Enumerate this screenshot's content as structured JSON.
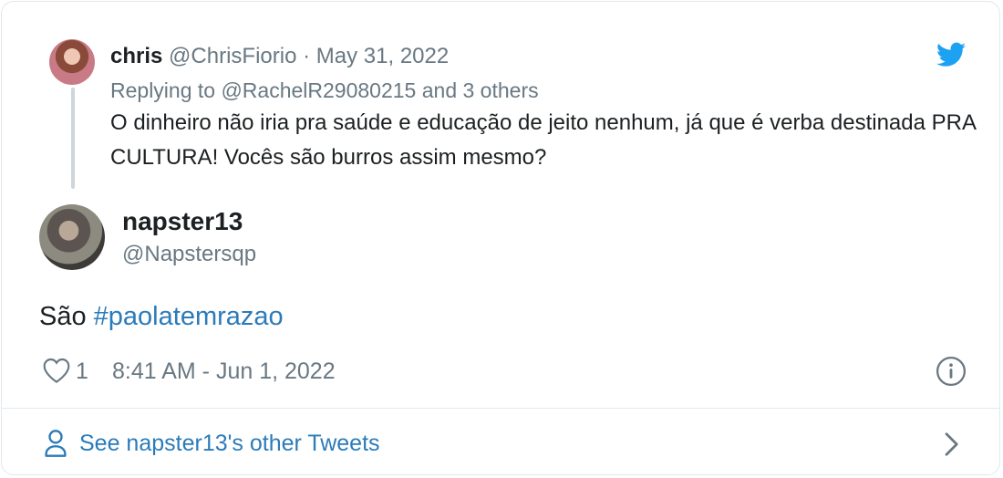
{
  "parent_tweet": {
    "name": "chris",
    "handle": "@ChrisFiorio",
    "separator": "·",
    "date": "May 31, 2022",
    "replying_to": "Replying to @RachelR29080215 and 3 others",
    "text": "O dinheiro não iria pra saúde e educação de jeito nenhum, já que é verba destinada PRA CULTURA! Vocês são burros assim mesmo?"
  },
  "main_tweet": {
    "name": "napster13",
    "handle": "@Napstersqp",
    "text_prefix": "São ",
    "hashtag": "#paolatemrazao",
    "likes": "1",
    "timestamp": "8:41 AM - Jun 1, 2022"
  },
  "footer": {
    "label": "See napster13's other Tweets"
  },
  "colors": {
    "brand_blue": "#1da1f2",
    "link_blue": "#2b7bb9",
    "muted_gray": "#697882",
    "border": "#e1e8ed"
  },
  "icons": {
    "brand": "twitter-bird-icon",
    "like": "heart-icon",
    "info": "info-icon",
    "footer_person": "person-icon",
    "footer_chevron": "chevron-right-icon"
  }
}
